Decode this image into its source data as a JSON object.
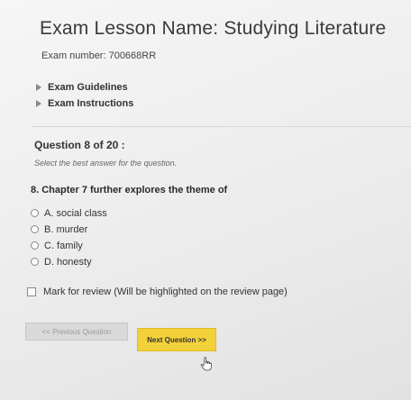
{
  "header": {
    "title": "Exam Lesson Name: Studying Literature",
    "exam_number": "Exam number: 700668RR"
  },
  "toggles": {
    "guidelines": "Exam Guidelines",
    "instructions": "Exam Instructions"
  },
  "question": {
    "count": "Question 8 of 20 :",
    "instruction": "Select the best answer for the question.",
    "text": "8.  Chapter 7 further explores the theme of",
    "options": [
      {
        "label": "A. social class"
      },
      {
        "label": "B. murder"
      },
      {
        "label": "C. family"
      },
      {
        "label": "D. honesty"
      }
    ],
    "review_label": "Mark for review (Will be highlighted on the review page)"
  },
  "buttons": {
    "previous": "<< Previous Question",
    "next": "Next Question >>"
  },
  "colors": {
    "next_button": "#f3d13a",
    "previous_button": "#d9d9d9"
  },
  "icons": {
    "cursor": "hand-pointer-icon",
    "toggle": "triangle-right-icon"
  }
}
